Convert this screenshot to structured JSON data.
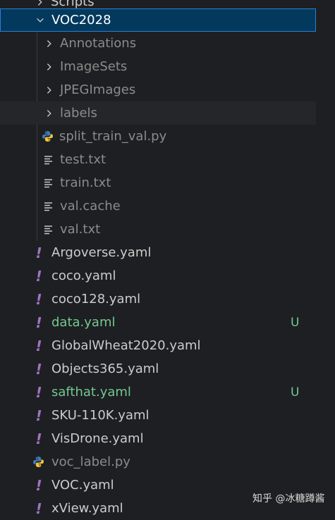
{
  "tree": {
    "top_partial": "Scripts",
    "folder": "VOC2028",
    "subfolders": [
      "Annotations",
      "ImageSets",
      "JPEGImages",
      "labels"
    ],
    "folder_files": [
      "split_train_val.py",
      "test.txt",
      "train.txt",
      "val.cache",
      "val.txt"
    ],
    "files": [
      {
        "name": "Argoverse.yaml",
        "status": ""
      },
      {
        "name": "coco.yaml",
        "status": ""
      },
      {
        "name": "coco128.yaml",
        "status": ""
      },
      {
        "name": "data.yaml",
        "status": "U"
      },
      {
        "name": "GlobalWheat2020.yaml",
        "status": ""
      },
      {
        "name": "Objects365.yaml",
        "status": ""
      },
      {
        "name": "safthat.yaml",
        "status": "U"
      },
      {
        "name": "SKU-110K.yaml",
        "status": ""
      },
      {
        "name": "VisDrone.yaml",
        "status": ""
      },
      {
        "name": "voc_label.py",
        "status": ""
      },
      {
        "name": "VOC.yaml",
        "status": ""
      },
      {
        "name": "xView.yaml",
        "status": ""
      }
    ]
  },
  "watermark": "知乎 @冰糖蹲酱",
  "colors": {
    "selection_bg": "#04395e",
    "untracked": "#73c991",
    "yaml_icon": "#a074c4",
    "python_blue": "#3f7cc0",
    "python_yellow": "#f4c53a"
  }
}
